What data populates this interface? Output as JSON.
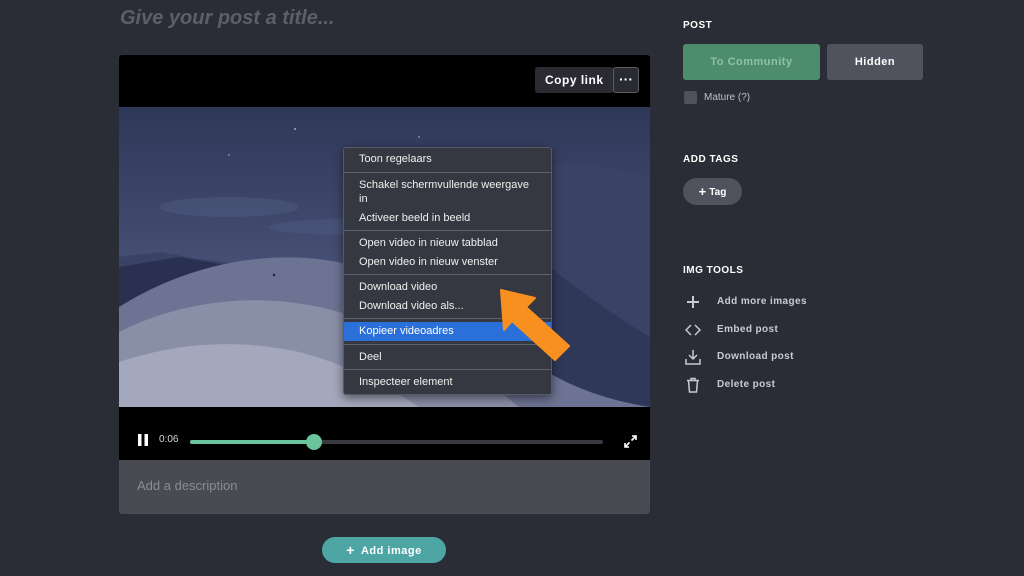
{
  "post_title": {
    "placeholder": "Give your post a title..."
  },
  "media": {
    "copy_link_label": "Copy link",
    "more_label": "···",
    "context_menu": [
      [
        "Toon regelaars"
      ],
      [
        "Schakel schermvullende weergave in",
        "Activeer beeld in beeld"
      ],
      [
        "Open video in nieuw tabblad",
        "Open video in nieuw venster"
      ],
      [
        "Download video",
        "Download video als..."
      ],
      [
        "Kopieer videoadres"
      ],
      [
        "Deel"
      ],
      [
        "Inspecteer element"
      ]
    ],
    "highlighted_item": "Kopieer videoadres",
    "player": {
      "time": "0:06",
      "progress": 0.3
    }
  },
  "description": {
    "placeholder": "Add a description"
  },
  "add_image_label": "Add image",
  "sidebar": {
    "post_heading": "POST",
    "community_label": "To Community",
    "hidden_label": "Hidden",
    "mature_label": "Mature (?)",
    "tags_heading": "ADD TAGS",
    "tag_label": "Tag",
    "tools_heading": "IMG TOOLS",
    "tools": [
      {
        "label": "Add more images",
        "icon": "plus-icon"
      },
      {
        "label": "Embed post",
        "icon": "code-icon"
      },
      {
        "label": "Download post",
        "icon": "download-icon"
      },
      {
        "label": "Delete post",
        "icon": "trash-icon"
      }
    ]
  },
  "colors": {
    "background": "#2b2d36",
    "accent_green": "#6bc49c",
    "accent_teal": "#4ea6a4",
    "menu_highlight": "#2b6fd8",
    "arrow_orange": "#f7901e"
  }
}
